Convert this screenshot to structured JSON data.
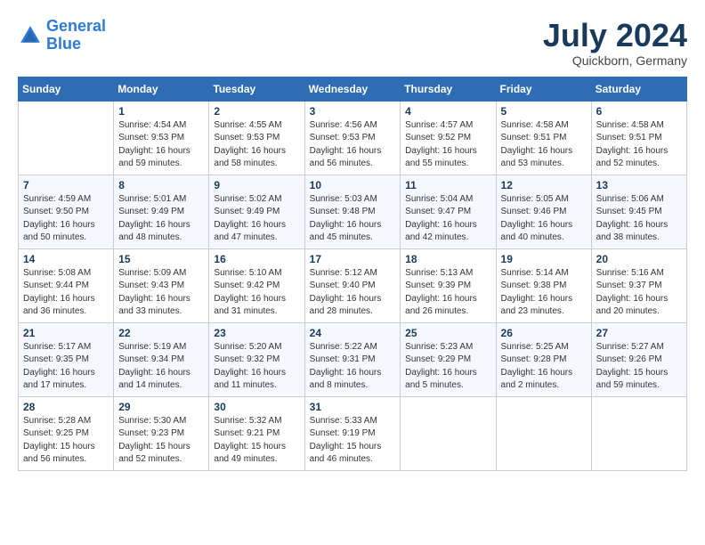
{
  "logo": {
    "line1": "General",
    "line2": "Blue"
  },
  "title": "July 2024",
  "subtitle": "Quickborn, Germany",
  "headers": [
    "Sunday",
    "Monday",
    "Tuesday",
    "Wednesday",
    "Thursday",
    "Friday",
    "Saturday"
  ],
  "weeks": [
    [
      {
        "day": "",
        "info": ""
      },
      {
        "day": "1",
        "info": "Sunrise: 4:54 AM\nSunset: 9:53 PM\nDaylight: 16 hours\nand 59 minutes."
      },
      {
        "day": "2",
        "info": "Sunrise: 4:55 AM\nSunset: 9:53 PM\nDaylight: 16 hours\nand 58 minutes."
      },
      {
        "day": "3",
        "info": "Sunrise: 4:56 AM\nSunset: 9:53 PM\nDaylight: 16 hours\nand 56 minutes."
      },
      {
        "day": "4",
        "info": "Sunrise: 4:57 AM\nSunset: 9:52 PM\nDaylight: 16 hours\nand 55 minutes."
      },
      {
        "day": "5",
        "info": "Sunrise: 4:58 AM\nSunset: 9:51 PM\nDaylight: 16 hours\nand 53 minutes."
      },
      {
        "day": "6",
        "info": "Sunrise: 4:58 AM\nSunset: 9:51 PM\nDaylight: 16 hours\nand 52 minutes."
      }
    ],
    [
      {
        "day": "7",
        "info": "Sunrise: 4:59 AM\nSunset: 9:50 PM\nDaylight: 16 hours\nand 50 minutes."
      },
      {
        "day": "8",
        "info": "Sunrise: 5:01 AM\nSunset: 9:49 PM\nDaylight: 16 hours\nand 48 minutes."
      },
      {
        "day": "9",
        "info": "Sunrise: 5:02 AM\nSunset: 9:49 PM\nDaylight: 16 hours\nand 47 minutes."
      },
      {
        "day": "10",
        "info": "Sunrise: 5:03 AM\nSunset: 9:48 PM\nDaylight: 16 hours\nand 45 minutes."
      },
      {
        "day": "11",
        "info": "Sunrise: 5:04 AM\nSunset: 9:47 PM\nDaylight: 16 hours\nand 42 minutes."
      },
      {
        "day": "12",
        "info": "Sunrise: 5:05 AM\nSunset: 9:46 PM\nDaylight: 16 hours\nand 40 minutes."
      },
      {
        "day": "13",
        "info": "Sunrise: 5:06 AM\nSunset: 9:45 PM\nDaylight: 16 hours\nand 38 minutes."
      }
    ],
    [
      {
        "day": "14",
        "info": "Sunrise: 5:08 AM\nSunset: 9:44 PM\nDaylight: 16 hours\nand 36 minutes."
      },
      {
        "day": "15",
        "info": "Sunrise: 5:09 AM\nSunset: 9:43 PM\nDaylight: 16 hours\nand 33 minutes."
      },
      {
        "day": "16",
        "info": "Sunrise: 5:10 AM\nSunset: 9:42 PM\nDaylight: 16 hours\nand 31 minutes."
      },
      {
        "day": "17",
        "info": "Sunrise: 5:12 AM\nSunset: 9:40 PM\nDaylight: 16 hours\nand 28 minutes."
      },
      {
        "day": "18",
        "info": "Sunrise: 5:13 AM\nSunset: 9:39 PM\nDaylight: 16 hours\nand 26 minutes."
      },
      {
        "day": "19",
        "info": "Sunrise: 5:14 AM\nSunset: 9:38 PM\nDaylight: 16 hours\nand 23 minutes."
      },
      {
        "day": "20",
        "info": "Sunrise: 5:16 AM\nSunset: 9:37 PM\nDaylight: 16 hours\nand 20 minutes."
      }
    ],
    [
      {
        "day": "21",
        "info": "Sunrise: 5:17 AM\nSunset: 9:35 PM\nDaylight: 16 hours\nand 17 minutes."
      },
      {
        "day": "22",
        "info": "Sunrise: 5:19 AM\nSunset: 9:34 PM\nDaylight: 16 hours\nand 14 minutes."
      },
      {
        "day": "23",
        "info": "Sunrise: 5:20 AM\nSunset: 9:32 PM\nDaylight: 16 hours\nand 11 minutes."
      },
      {
        "day": "24",
        "info": "Sunrise: 5:22 AM\nSunset: 9:31 PM\nDaylight: 16 hours\nand 8 minutes."
      },
      {
        "day": "25",
        "info": "Sunrise: 5:23 AM\nSunset: 9:29 PM\nDaylight: 16 hours\nand 5 minutes."
      },
      {
        "day": "26",
        "info": "Sunrise: 5:25 AM\nSunset: 9:28 PM\nDaylight: 16 hours\nand 2 minutes."
      },
      {
        "day": "27",
        "info": "Sunrise: 5:27 AM\nSunset: 9:26 PM\nDaylight: 15 hours\nand 59 minutes."
      }
    ],
    [
      {
        "day": "28",
        "info": "Sunrise: 5:28 AM\nSunset: 9:25 PM\nDaylight: 15 hours\nand 56 minutes."
      },
      {
        "day": "29",
        "info": "Sunrise: 5:30 AM\nSunset: 9:23 PM\nDaylight: 15 hours\nand 52 minutes."
      },
      {
        "day": "30",
        "info": "Sunrise: 5:32 AM\nSunset: 9:21 PM\nDaylight: 15 hours\nand 49 minutes."
      },
      {
        "day": "31",
        "info": "Sunrise: 5:33 AM\nSunset: 9:19 PM\nDaylight: 15 hours\nand 46 minutes."
      },
      {
        "day": "",
        "info": ""
      },
      {
        "day": "",
        "info": ""
      },
      {
        "day": "",
        "info": ""
      }
    ]
  ]
}
